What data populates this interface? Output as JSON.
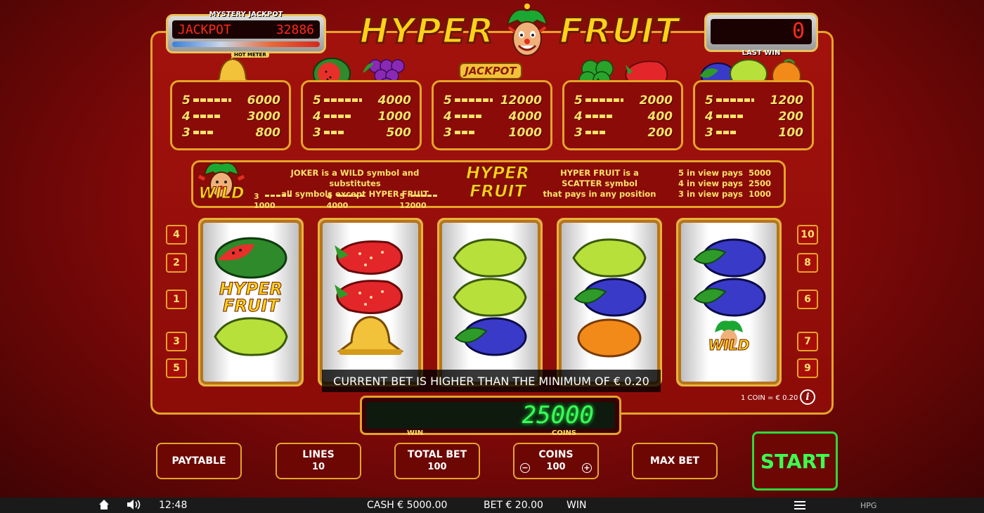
{
  "jackpot": {
    "title": "MYSTERY JACKPOT",
    "label": "JACKPOT",
    "value": "32886",
    "meter": "HOT METER",
    "meter_level": 0.38
  },
  "logo": {
    "word1": "HYPER",
    "word2": "FRUIT"
  },
  "last_win": {
    "value": "0",
    "label": "LAST WIN"
  },
  "paytable": [
    {
      "symbols": [
        "bell"
      ],
      "rows": [
        {
          "n": "5",
          "v": "6000"
        },
        {
          "n": "4",
          "v": "3000"
        },
        {
          "n": "3",
          "v": "800"
        }
      ]
    },
    {
      "symbols": [
        "watermelon",
        "grapes"
      ],
      "rows": [
        {
          "n": "5",
          "v": "4000"
        },
        {
          "n": "4",
          "v": "1000"
        },
        {
          "n": "3",
          "v": "500"
        }
      ]
    },
    {
      "symbols": [
        "jackpot-coins"
      ],
      "badge": "JACKPOT",
      "rows": [
        {
          "n": "5",
          "v": "12000"
        },
        {
          "n": "4",
          "v": "4000"
        },
        {
          "n": "3",
          "v": "1000"
        }
      ]
    },
    {
      "symbols": [
        "clover",
        "strawberry"
      ],
      "rows": [
        {
          "n": "5",
          "v": "2000"
        },
        {
          "n": "4",
          "v": "400"
        },
        {
          "n": "3",
          "v": "200"
        }
      ]
    },
    {
      "symbols": [
        "plum",
        "lemon",
        "orange"
      ],
      "rows": [
        {
          "n": "5",
          "v": "1200"
        },
        {
          "n": "4",
          "v": "200"
        },
        {
          "n": "3",
          "v": "100"
        }
      ]
    }
  ],
  "info": {
    "wild_label": "WILD",
    "wild_line1": "JOKER is a WILD symbol and substitutes",
    "wild_line2": "all symbols except HYPER FRUIT",
    "wild_pays": [
      {
        "n": "3",
        "v": "1000"
      },
      {
        "n": "4",
        "v": "4000"
      },
      {
        "n": "5",
        "v": "12000"
      }
    ],
    "scatter_logo1": "HYPER",
    "scatter_logo2": "FRUIT",
    "scatter_line1": "HYPER FRUIT is a",
    "scatter_line2": "SCATTER symbol",
    "scatter_line3": "that pays in any position",
    "scatter_pays": [
      {
        "label": "5 in view pays",
        "v": "5000"
      },
      {
        "label": "4 in view pays",
        "v": "2500"
      },
      {
        "label": "3 in view pays",
        "v": "1000"
      }
    ]
  },
  "reels": [
    [
      "watermelon",
      "hyper-fruit",
      "lemon"
    ],
    [
      "strawberry",
      "strawberry",
      "bell"
    ],
    [
      "lemon",
      "lemon",
      "plum"
    ],
    [
      "lemon",
      "plum",
      "orange"
    ],
    [
      "plum",
      "plum",
      "wild"
    ]
  ],
  "reel_texts": {
    "hyper1": "HYPER",
    "hyper2": "FRUIT",
    "wild": "WILD"
  },
  "lines_left": [
    "4",
    "2",
    "1",
    "3",
    "5"
  ],
  "lines_right": [
    "10",
    "8",
    "6",
    "7",
    "9"
  ],
  "message": "CURRENT BET IS HIGHER THAN THE MINIMUM OF € 0.20",
  "coin_info": "1 COIN = € 0.20",
  "info_icon": "i",
  "win_display": {
    "value": "25000",
    "label_left": "WIN",
    "label_right": "COINS"
  },
  "buttons": {
    "paytable": "PAYTABLE",
    "lines_label": "LINES",
    "lines_value": "10",
    "total_bet_label": "TOTAL BET",
    "total_bet_value": "100",
    "coins_label": "COINS",
    "coins_value": "100",
    "minus": "−",
    "plus": "+",
    "max_bet": "MAX BET",
    "start": "START"
  },
  "status_bar": {
    "time": "12:48",
    "cash": "CASH € 5000.00",
    "bet": "BET € 20.00",
    "win": "WIN",
    "brand": "HPG"
  },
  "colors": {
    "frame": "#e4a42a",
    "background": "#9a0d09",
    "lcd_red": "#ff2a1a",
    "lcd_green": "#39ff5a",
    "pay_text": "#ffe16a",
    "start_green": "#2fd83a"
  }
}
